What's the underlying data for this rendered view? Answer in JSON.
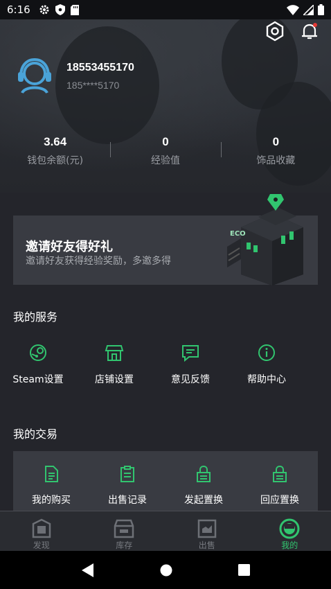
{
  "status_bar": {
    "time": "6:16"
  },
  "profile": {
    "phone": "18553455170",
    "masked_phone": "185****5170"
  },
  "stats": [
    {
      "value": "3.64",
      "label": "钱包余额(元)"
    },
    {
      "value": "0",
      "label": "经验值"
    },
    {
      "value": "0",
      "label": "饰品收藏"
    }
  ],
  "banner": {
    "title": "邀请好友得好礼",
    "subtitle": "邀请好友获得经验奖励，多邀多得",
    "art_text": "ECO"
  },
  "services": {
    "title": "我的服务",
    "items": [
      {
        "label": "Steam设置",
        "icon": "steam-icon"
      },
      {
        "label": "店铺设置",
        "icon": "store-icon"
      },
      {
        "label": "意见反馈",
        "icon": "feedback-icon"
      },
      {
        "label": "帮助中心",
        "icon": "info-icon"
      }
    ]
  },
  "trades": {
    "title": "我的交易",
    "items": [
      {
        "label": "我的购买",
        "icon": "document-icon"
      },
      {
        "label": "出售记录",
        "icon": "clipboard-icon"
      },
      {
        "label": "发起置换",
        "icon": "lock-icon"
      },
      {
        "label": "回应置换",
        "icon": "lock-icon"
      }
    ]
  },
  "tabs": [
    {
      "label": "发现",
      "icon": "discover-icon",
      "active": false
    },
    {
      "label": "库存",
      "icon": "inventory-icon",
      "active": false
    },
    {
      "label": "出售",
      "icon": "sell-icon",
      "active": false
    },
    {
      "label": "我的",
      "icon": "profile-icon",
      "active": true
    }
  ],
  "colors": {
    "accent": "#31c56f",
    "background": "#24252b",
    "card": "#393b42",
    "notification_dot": "#e53935"
  }
}
